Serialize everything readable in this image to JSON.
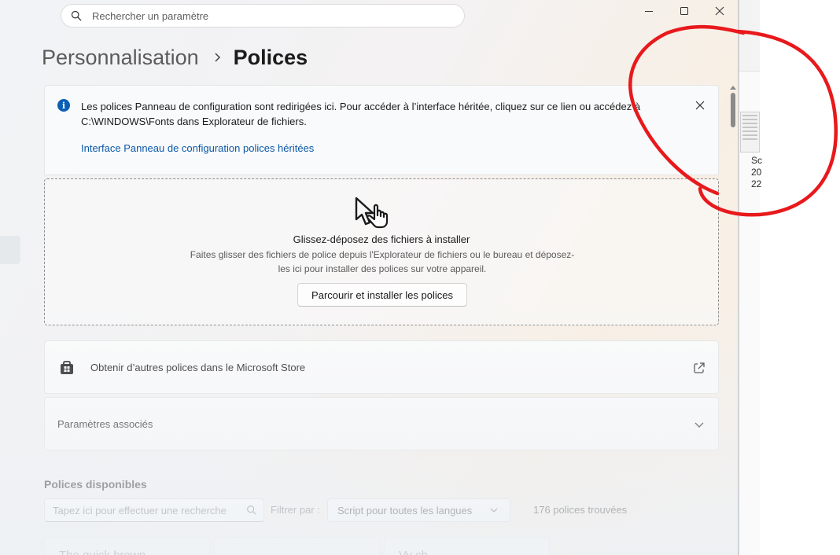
{
  "search": {
    "placeholder": "Rechercher un paramètre"
  },
  "window_controls": {
    "minimize": "minimize",
    "maximize": "maximize",
    "close": "close"
  },
  "breadcrumb": {
    "parent": "Personnalisation",
    "separator": "chevron-right",
    "current": "Polices"
  },
  "info_bar": {
    "text": "Les polices Panneau de configuration sont redirigées ici. Pour accéder à l’interface héritée, cliquez sur ce lien ou accédez à C:\\WINDOWS\\Fonts dans Explorateur de fichiers.",
    "link": "Interface Panneau de configuration polices héritées",
    "icon": "info-icon"
  },
  "drop_zone": {
    "title": "Glissez-déposez des fichiers à installer",
    "description": "Faites glisser des fichiers de police depuis l'Explorateur de fichiers ou le bureau et déposez-les ici pour installer des polices sur votre appareil.",
    "button": "Parcourir et installer les polices"
  },
  "store_card": {
    "label": "Obtenir d’autres polices dans le Microsoft Store",
    "icon": "store-icon",
    "action_icon": "external-link-icon"
  },
  "related_card": {
    "label": "Paramètres associés",
    "action_icon": "chevron-down-icon"
  },
  "available": {
    "title": "Polices disponibles",
    "search_placeholder": "Tapez ici pour effectuer une recherche",
    "filter_label": "Filtrer par :",
    "filter_value": "Script pour toutes les langues",
    "count": "176 polices trouvées"
  },
  "font_tiles": [
    "The quick brown",
    "",
    "Vy ch"
  ],
  "desktop_thumbnail": {
    "lines": [
      "Sc",
      "20",
      "22"
    ]
  },
  "annotation": {
    "color": "#e8191c",
    "shape": "hand-drawn circle"
  }
}
